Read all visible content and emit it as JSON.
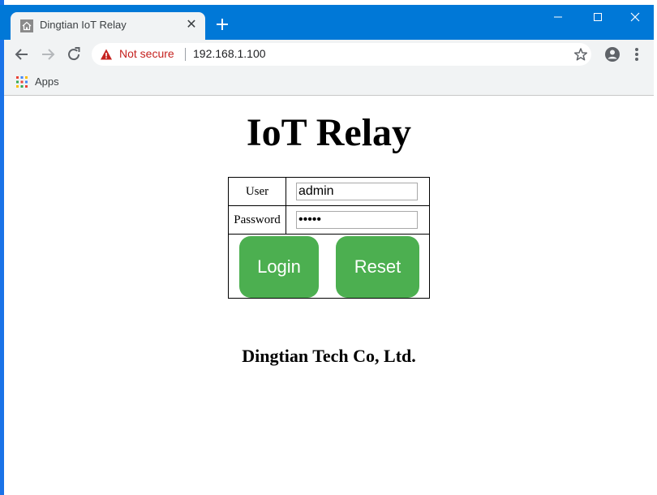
{
  "browser": {
    "tab": {
      "title": "Dingtian IoT Relay",
      "favicon": "home-icon"
    },
    "address_bar": {
      "security_label": "Not secure",
      "url": "192.168.1.100"
    },
    "bookmarks": {
      "apps_label": "Apps"
    }
  },
  "page": {
    "title": "IoT Relay",
    "form": {
      "user_label": "User",
      "user_value": "admin",
      "password_label": "Password",
      "password_value": "admin",
      "login_label": "Login",
      "reset_label": "Reset"
    },
    "footer": "Dingtian Tech Co, Ltd."
  },
  "colors": {
    "titlebar": "#0078d7",
    "button_green": "#4caf50",
    "warning_red": "#c5221f"
  }
}
